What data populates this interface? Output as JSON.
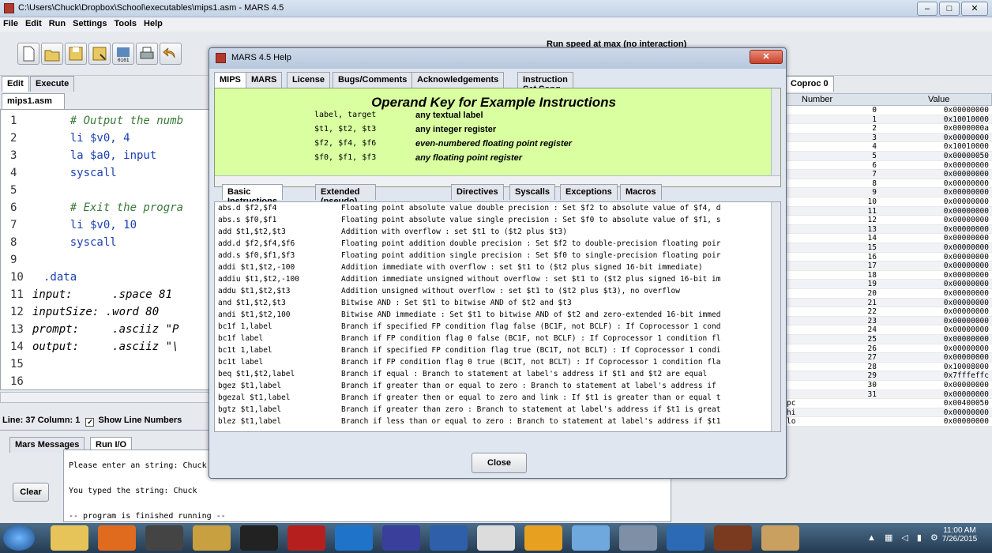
{
  "window": {
    "title": "C:\\Users\\Chuck\\Dropbox\\School\\executables\\mips1.asm - MARS 4.5",
    "min": "–",
    "max": "□",
    "close": "✕"
  },
  "menu": [
    "File",
    "Edit",
    "Run",
    "Settings",
    "Tools",
    "Help"
  ],
  "toolbar": {
    "run_speed": "Run speed at max (no interaction)"
  },
  "left_tabs": [
    "Edit",
    "Execute"
  ],
  "file_tab": "mips1.asm",
  "editor": {
    "line_numbers": [
      "1",
      "2",
      "3",
      "4",
      "5",
      "6",
      "7",
      "8",
      "9",
      "10",
      "11",
      "12",
      "13",
      "14",
      "15",
      "16"
    ],
    "lines": [
      "    # Output the numb",
      "    li $v0, 4",
      "    la $a0, input",
      "    syscall",
      "",
      "    # Exit the progra",
      "    li $v0, 10",
      "    syscall",
      "",
      ".data",
      "input:      .space 81",
      "inputSize: .word 80",
      "prompt:     .asciiz \"P",
      "output:     .asciiz \"\\",
      "",
      ""
    ]
  },
  "status": {
    "line_col": "Line: 37 Column: 1",
    "show_line_numbers": "Show Line Numbers"
  },
  "messages": {
    "tabs": [
      "Mars Messages",
      "Run I/O"
    ],
    "clear": "Clear",
    "lines": [
      "Please enter an string: Chuck",
      "",
      "You typed the string:  Chuck",
      "",
      "-- program is finished running --"
    ]
  },
  "registers": {
    "tab": "Coproc 0",
    "header_number": "Number",
    "header_value": "Value",
    "rows": [
      [
        "0",
        "0x00000000"
      ],
      [
        "1",
        "0x10010000"
      ],
      [
        "2",
        "0x0000000a"
      ],
      [
        "3",
        "0x00000000"
      ],
      [
        "4",
        "0x10010000"
      ],
      [
        "5",
        "0x00000050"
      ],
      [
        "6",
        "0x00000000"
      ],
      [
        "7",
        "0x00000000"
      ],
      [
        "8",
        "0x00000000"
      ],
      [
        "9",
        "0x00000000"
      ],
      [
        "10",
        "0x00000000"
      ],
      [
        "11",
        "0x00000000"
      ],
      [
        "12",
        "0x00000000"
      ],
      [
        "13",
        "0x00000000"
      ],
      [
        "14",
        "0x00000000"
      ],
      [
        "15",
        "0x00000000"
      ],
      [
        "16",
        "0x00000000"
      ],
      [
        "17",
        "0x00000000"
      ],
      [
        "18",
        "0x00000000"
      ],
      [
        "19",
        "0x00000000"
      ],
      [
        "20",
        "0x00000000"
      ],
      [
        "21",
        "0x00000000"
      ],
      [
        "22",
        "0x00000000"
      ],
      [
        "23",
        "0x00000000"
      ],
      [
        "24",
        "0x00000000"
      ],
      [
        "25",
        "0x00000000"
      ],
      [
        "26",
        "0x00000000"
      ],
      [
        "27",
        "0x00000000"
      ],
      [
        "28",
        "0x10008000"
      ],
      [
        "29",
        "0x7fffeffc"
      ],
      [
        "30",
        "0x00000000"
      ],
      [
        "31",
        "0x00000000"
      ]
    ],
    "special": [
      [
        "pc",
        "0x00400050"
      ],
      [
        "hi",
        "0x00000000"
      ],
      [
        "lo",
        "0x00000000"
      ]
    ]
  },
  "help": {
    "title": "MARS 4.5 Help",
    "tabs": [
      "MIPS",
      "MARS",
      "License",
      "Bugs/Comments",
      "Acknowledgements",
      "Instruction Set Song"
    ],
    "operand_title": "Operand Key for Example Instructions",
    "operands": [
      [
        "label, target",
        "any textual label"
      ],
      [
        "$t1, $t2, $t3",
        "any integer register"
      ],
      [
        "$f2, $f4, $f6",
        "even-numbered floating point register"
      ],
      [
        "$f0, $f1, $f3",
        "any floating point register"
      ]
    ],
    "inst_tabs": [
      "Basic Instructions",
      "Extended (pseudo) Instructions",
      "Directives",
      "Syscalls",
      "Exceptions",
      "Macros"
    ],
    "instructions": [
      [
        "abs.d $f2,$f4",
        "Floating point absolute value double precision : Set $f2 to absolute value of $f4, d"
      ],
      [
        "abs.s $f0,$f1",
        "Floating point absolute value single precision : Set $f0 to absolute value of $f1, s"
      ],
      [
        "add $t1,$t2,$t3",
        "Addition with overflow : set $t1 to ($t2 plus $t3)"
      ],
      [
        "add.d $f2,$f4,$f6",
        "Floating point addition double precision : Set $f2 to double-precision floating poir"
      ],
      [
        "add.s $f0,$f1,$f3",
        "Floating point addition single precision : Set $f0 to single-precision floating poir"
      ],
      [
        "addi $t1,$t2,-100",
        "Addition immediate with overflow : set $t1 to ($t2 plus signed 16-bit immediate)"
      ],
      [
        "addiu $t1,$t2,-100",
        "Addition immediate unsigned without overflow : set $t1 to ($t2 plus signed 16-bit im"
      ],
      [
        "addu $t1,$t2,$t3",
        "Addition unsigned without overflow : set $t1 to ($t2 plus $t3), no overflow"
      ],
      [
        "and $t1,$t2,$t3",
        "Bitwise AND : Set $t1 to bitwise AND of $t2 and $t3"
      ],
      [
        "andi $t1,$t2,100",
        "Bitwise AND immediate : Set $t1 to bitwise AND of $t2 and zero-extended 16-bit immed"
      ],
      [
        "bc1f 1,label",
        "Branch if specified FP condition flag false (BC1F, not BCLF) : If Coprocessor 1 cond"
      ],
      [
        "bc1f label",
        "Branch if FP condition flag 0 false (BC1F, not BCLF) : If Coprocessor 1 condition fl"
      ],
      [
        "bc1t 1,label",
        "Branch if specified FP condition flag true (BC1T, not BCLT) : If Coprocessor 1 condi"
      ],
      [
        "bc1t label",
        "Branch if FP condition flag 0 true (BC1T, not BCLT) : If Coprocessor 1 condition fla"
      ],
      [
        "beq $t1,$t2,label",
        "Branch if equal : Branch to statement at label's address if $t1 and $t2 are equal"
      ],
      [
        "bgez $t1,label",
        "Branch if greater than or equal to zero : Branch to statement at label's address if"
      ],
      [
        "bgezal $t1,label",
        "Branch if greater then or equal to zero and link : If $t1 is greater than or equal t"
      ],
      [
        "bgtz $t1,label",
        "Branch if greater than zero : Branch to statement at label's address if $t1 is great"
      ],
      [
        "blez $t1,label",
        "Branch if less than or equal to zero : Branch to statement at label's address if $t1"
      ]
    ],
    "close": "Close",
    "close_x": "✕"
  },
  "taskbar": {
    "time": "11:00 AM",
    "date": "7/26/2015"
  }
}
